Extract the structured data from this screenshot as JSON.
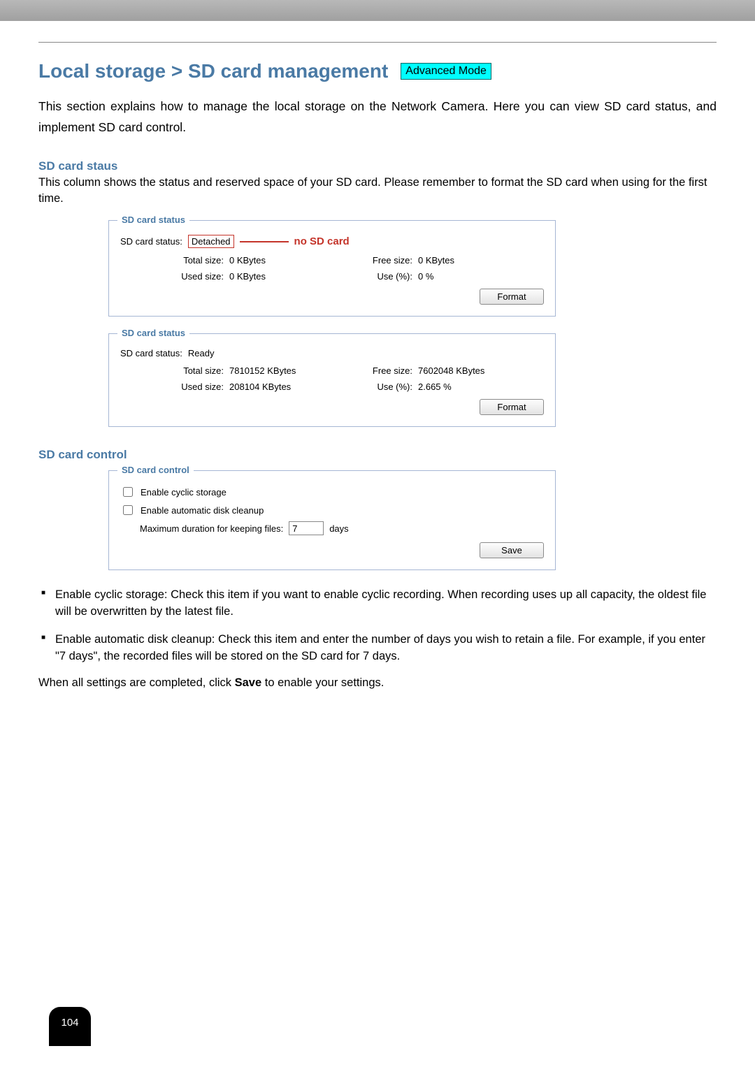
{
  "header": {
    "title": "Local storage > SD card management",
    "mode_badge": "Advanced Mode"
  },
  "intro": "This section explains how to manage the local storage on the Network Camera. Here you can view SD card status, and implement SD card control.",
  "status_section": {
    "heading": "SD card staus",
    "text": "This column shows the status and reserved space of your SD card. Please remember to format the SD card when using for the first time."
  },
  "status_box_detached": {
    "legend": "SD card status",
    "status_label": "SD card status:",
    "status_value": "Detached",
    "callout": "no SD card",
    "total_label": "Total size:",
    "total_value": "0  KBytes",
    "free_label": "Free size:",
    "free_value": "0  KBytes",
    "used_label": "Used size:",
    "used_value": "0  KBytes",
    "use_pct_label": "Use (%):",
    "use_pct_value": "0 %",
    "format_btn": "Format"
  },
  "status_box_ready": {
    "legend": "SD card status",
    "status_label": "SD card status:",
    "status_value": "Ready",
    "total_label": "Total size:",
    "total_value": "7810152  KBytes",
    "free_label": "Free size:",
    "free_value": "7602048  KBytes",
    "used_label": "Used size:",
    "used_value": "208104  KBytes",
    "use_pct_label": "Use (%):",
    "use_pct_value": "2.665 %",
    "format_btn": "Format"
  },
  "control_section": {
    "heading": "SD card control"
  },
  "control_box": {
    "legend": "SD card control",
    "enable_cyclic": "Enable cyclic storage",
    "enable_cleanup": "Enable automatic disk cleanup",
    "max_duration_label": "Maximum duration for keeping files:",
    "max_duration_value": "7",
    "max_duration_unit": "days",
    "save_btn": "Save"
  },
  "bullets": {
    "b1": "Enable cyclic storage: Check this item if you want to enable cyclic recording. When recording uses up all capacity, the oldest file will be overwritten by the latest file.",
    "b2": "Enable automatic disk cleanup: Check this item and enter the number of days you wish to retain a file. For example, if you enter \"7 days\", the recorded files will be stored on the SD card for 7 days."
  },
  "closing_pre": "When all settings are completed, click ",
  "closing_bold": "Save",
  "closing_post": " to enable your settings.",
  "page_number": "104"
}
